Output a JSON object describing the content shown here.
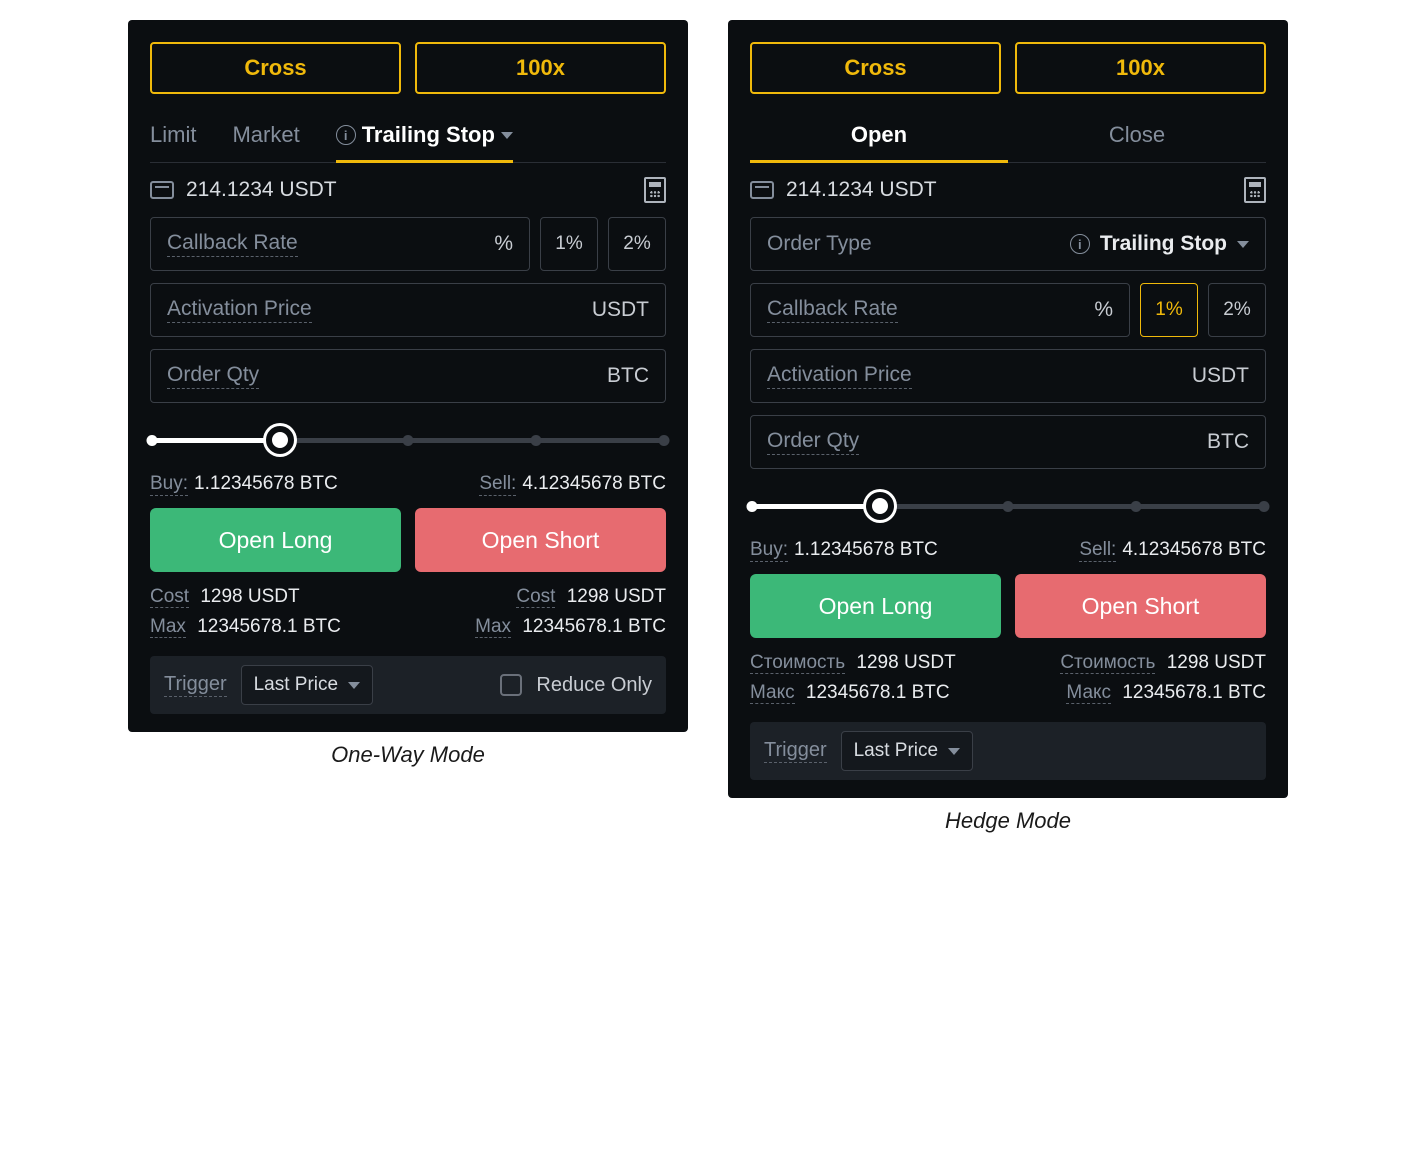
{
  "captions": {
    "left": "One-Way Mode",
    "right": "Hedge Mode"
  },
  "left": {
    "margin_mode": "Cross",
    "leverage": "100x",
    "tabs": {
      "limit": "Limit",
      "market": "Market",
      "trailing": "Trailing Stop"
    },
    "balance": "214.1234 USDT",
    "callback": {
      "label": "Callback Rate",
      "unit": "%",
      "p1": "1%",
      "p2": "2%"
    },
    "activation": {
      "label": "Activation Price",
      "unit": "USDT"
    },
    "qty": {
      "label": "Order Qty",
      "unit": "BTC"
    },
    "buy": {
      "label": "Buy:",
      "value": "1.12345678 BTC"
    },
    "sell": {
      "label": "Sell:",
      "value": "4.12345678 BTC"
    },
    "open_long": "Open Long",
    "open_short": "Open Short",
    "cost_label": "Cost",
    "max_label": "Max",
    "cost_l": "1298 USDT",
    "cost_r": "1298 USDT",
    "max_l": "12345678.1 BTC",
    "max_r": "12345678.1 BTC",
    "trigger_label": "Trigger",
    "trigger_value": "Last Price",
    "reduce_only": "Reduce Only"
  },
  "right": {
    "margin_mode": "Cross",
    "leverage": "100x",
    "tabs": {
      "open": "Open",
      "close": "Close"
    },
    "balance": "214.1234 USDT",
    "order_type": {
      "label": "Order Type",
      "value": "Trailing Stop"
    },
    "callback": {
      "label": "Callback Rate",
      "unit": "%",
      "p1": "1%",
      "p2": "2%"
    },
    "activation": {
      "label": "Activation Price",
      "unit": "USDT"
    },
    "qty": {
      "label": "Order Qty",
      "unit": "BTC"
    },
    "buy": {
      "label": "Buy:",
      "value": "1.12345678 BTC"
    },
    "sell": {
      "label": "Sell:",
      "value": "4.12345678 BTC"
    },
    "open_long": "Open Long",
    "open_short": "Open Short",
    "cost_label": "Стоимость",
    "max_label": "Макс",
    "cost_l": "1298 USDT",
    "cost_r": "1298 USDT",
    "max_l": "12345678.1 BTC",
    "max_r": "12345678.1 BTC",
    "trigger_label": "Trigger",
    "trigger_value": "Last Price"
  }
}
